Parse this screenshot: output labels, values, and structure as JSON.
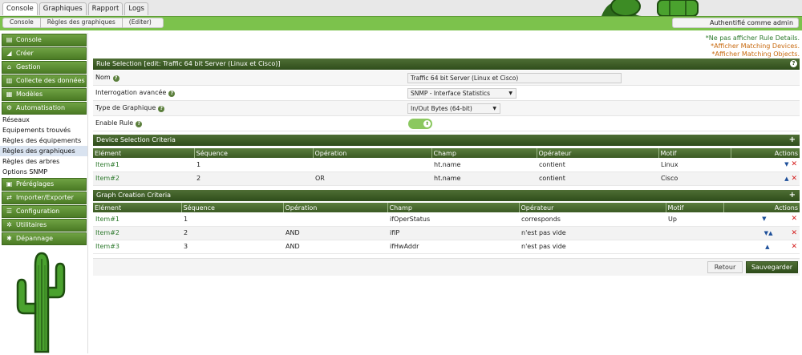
{
  "tabs": [
    "Console",
    "Graphiques",
    "Rapport",
    "Logs"
  ],
  "breadcrumbs": [
    "Console",
    "Règles des graphiques",
    "(Editer)"
  ],
  "user": "Authentifié comme admin",
  "sidebar": {
    "menus_top": [
      {
        "label": "Console",
        "icon": "book-icon"
      },
      {
        "label": "Créer",
        "icon": "chart-icon"
      },
      {
        "label": "Gestion",
        "icon": "home-icon"
      },
      {
        "label": "Collecte des données",
        "icon": "database-icon"
      },
      {
        "label": "Modèles",
        "icon": "template-icon"
      },
      {
        "label": "Automatisation",
        "icon": "gear-icon"
      }
    ],
    "subitems": [
      "Réseaux",
      "Equipements trouvés",
      "Règles des équipements",
      "Règles des graphiques",
      "Règles des arbres",
      "Options SNMP"
    ],
    "menus_bottom": [
      {
        "label": "Préréglages",
        "icon": "preset-icon"
      },
      {
        "label": "Importer/Exporter",
        "icon": "exchange-icon"
      },
      {
        "label": "Configuration",
        "icon": "sliders-icon"
      },
      {
        "label": "Utilitaires",
        "icon": "tools-icon"
      },
      {
        "label": "Dépannage",
        "icon": "bug-icon"
      }
    ]
  },
  "links": [
    "*Ne pas afficher Rule Details.",
    "*Afficher Matching Devices.",
    "*Afficher Matching Objects."
  ],
  "rule": {
    "title": "Rule Selection [edit: Traffic 64 bit Server (Linux et Cisco)]",
    "name_label": "Nom",
    "name_value": "Traffic 64 bit Server (Linux et Cisco)",
    "query_label": "Interrogation avancée",
    "query_value": "SNMP - Interface Statistics",
    "type_label": "Type de Graphique",
    "type_value": "In/Out Bytes (64-bit)",
    "enable_label": "Enable Rule"
  },
  "device": {
    "title": "Device Selection Criteria",
    "headers": [
      "Elément",
      "Séquence",
      "Opération",
      "Champ",
      "Opérateur",
      "Motif",
      "Actions"
    ],
    "rows": [
      {
        "item": "Item#1",
        "seq": "1",
        "op": "",
        "field": "ht.name",
        "operator": "contient",
        "pattern": "Linux"
      },
      {
        "item": "Item#2",
        "seq": "2",
        "op": "OR",
        "field": "ht.name",
        "operator": "contient",
        "pattern": "Cisco"
      }
    ]
  },
  "graph": {
    "title": "Graph Creation Criteria",
    "headers": [
      "Elément",
      "Séquence",
      "Opération",
      "Champ",
      "Opérateur",
      "Motif",
      "Actions"
    ],
    "rows": [
      {
        "item": "Item#1",
        "seq": "1",
        "op": "",
        "field": "ifOperStatus",
        "operator": "corresponds",
        "pattern": "Up"
      },
      {
        "item": "Item#2",
        "seq": "2",
        "op": "AND",
        "field": "ifIP",
        "operator": "n'est pas vide",
        "pattern": ""
      },
      {
        "item": "Item#3",
        "seq": "3",
        "op": "AND",
        "field": "ifHwAddr",
        "operator": "n'est pas vide",
        "pattern": ""
      }
    ]
  },
  "buttons": {
    "back": "Retour",
    "save": "Sauvegarder"
  },
  "icons": {
    "plus": "+",
    "help": "?"
  }
}
